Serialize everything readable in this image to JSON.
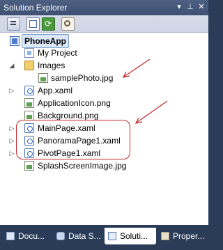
{
  "window": {
    "title": "Solution Explorer",
    "pin_icon": "pin-icon",
    "close_icon": "close-icon",
    "dropdown_icon": "dropdown-icon"
  },
  "toolbar": {
    "buttons": [
      {
        "name": "properties-button",
        "icon": "properties-icon"
      },
      {
        "name": "show-all-files-button",
        "icon": "show-all-files-icon"
      },
      {
        "name": "refresh-button",
        "icon": "refresh-icon"
      },
      {
        "name": "view-class-diagram-button",
        "icon": "class-diagram-icon"
      }
    ]
  },
  "tree": {
    "project": "PhoneApp",
    "items": [
      {
        "label": "My Project",
        "icon": "my-project-icon"
      },
      {
        "label": "Images",
        "icon": "folder-icon",
        "expanded": true
      },
      {
        "label": "samplePhoto.jpg",
        "icon": "image-file-icon"
      },
      {
        "label": "App.xaml",
        "icon": "xaml-file-icon"
      },
      {
        "label": "ApplicationIcon.png",
        "icon": "image-file-icon"
      },
      {
        "label": "Background.png",
        "icon": "image-file-icon"
      },
      {
        "label": "MainPage.xaml",
        "icon": "xaml-file-icon"
      },
      {
        "label": "PanoramaPage1.xaml",
        "icon": "xaml-file-icon"
      },
      {
        "label": "PivotPage1.xaml",
        "icon": "xaml-file-icon"
      },
      {
        "label": "SplashScreenImage.jpg",
        "icon": "image-file-icon"
      }
    ]
  },
  "tabs": [
    {
      "label": "Docu...",
      "icon": "document-outline-icon"
    },
    {
      "label": "Data S...",
      "icon": "data-sources-icon"
    },
    {
      "label": "Soluti...",
      "icon": "solution-explorer-icon",
      "active": true
    },
    {
      "label": "Proper...",
      "icon": "properties-icon"
    }
  ],
  "colors": {
    "annotation_red": "#c4262b",
    "titlebar": "#3e5073",
    "selection": "#dbe6f7"
  }
}
